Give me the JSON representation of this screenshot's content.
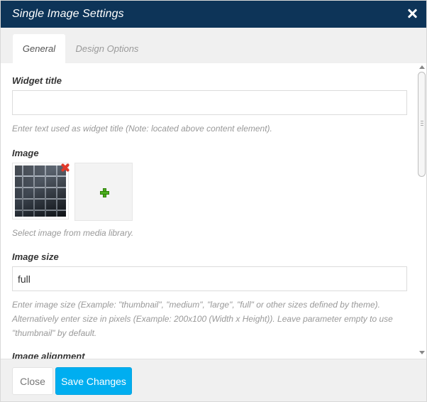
{
  "dialog": {
    "title": "Single Image Settings",
    "close_icon": "close-icon"
  },
  "tabs": [
    {
      "label": "General",
      "active": true
    },
    {
      "label": "Design Options",
      "active": false
    }
  ],
  "fields": {
    "widget_title": {
      "label": "Widget title",
      "value": "",
      "hint": "Enter text used as widget title (Note: located above content element)."
    },
    "image": {
      "label": "Image",
      "remove_icon": "remove-icon",
      "add_icon": "plus-icon",
      "hint": "Select image from media library."
    },
    "image_size": {
      "label": "Image size",
      "value": "full",
      "hint": "Enter image size (Example: \"thumbnail\", \"medium\", \"large\", \"full\" or other sizes defined by theme). Alternatively enter size in pixels (Example: 200x100 (Width x Height)). Leave parameter empty to use \"thumbnail\" by default."
    },
    "image_alignment": {
      "label": "Image alignment"
    }
  },
  "footer": {
    "close_label": "Close",
    "save_label": "Save Changes"
  },
  "colors": {
    "titlebar": "#0d3458",
    "primary_button": "#00aef0",
    "add_icon": "#4caf1e",
    "remove_icon": "#e0392a"
  }
}
